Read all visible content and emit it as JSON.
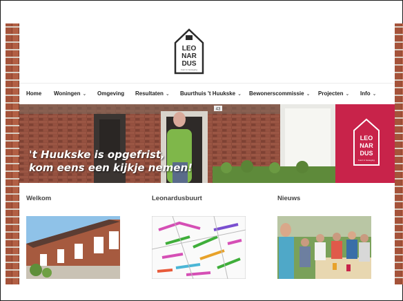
{
  "logo": {
    "lines": [
      "LEO",
      "NAR",
      "DUS"
    ],
    "sub": "buurt in beweging"
  },
  "nav": {
    "items": [
      {
        "label": "Home",
        "chevron": false
      },
      {
        "label": "Woningen",
        "chevron": true
      },
      {
        "label": "Omgeving",
        "chevron": false
      },
      {
        "label": "Resultaten",
        "chevron": true
      },
      {
        "label": "Buurthuis 't Huukske",
        "chevron": true
      },
      {
        "label": "Bewonerscommissie",
        "chevron": true
      },
      {
        "label": "Projecten",
        "chevron": true
      },
      {
        "label": "Info",
        "chevron": true
      }
    ],
    "chevron_glyph": "⌄",
    "search_glyph": "🔍"
  },
  "hero": {
    "line1": "'t Huukske is opgefrist,",
    "line2": "kom eens een kijkje nemen!",
    "house_number": "43"
  },
  "columns": [
    {
      "title": "Welkom"
    },
    {
      "title": "Leonardusbuurt"
    },
    {
      "title": "Nieuws"
    }
  ],
  "colors": {
    "brand_pink": "#c8234a",
    "brick": "#9a4a33"
  }
}
